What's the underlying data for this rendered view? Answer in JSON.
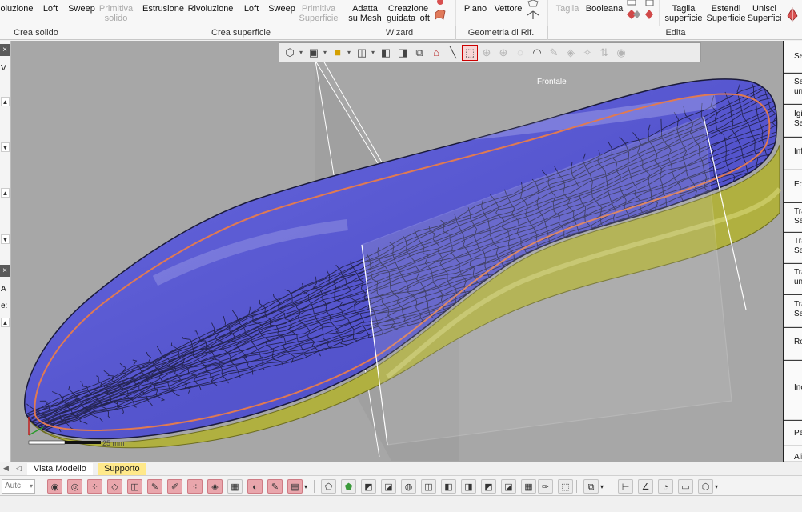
{
  "ribbon": {
    "crea_solido": {
      "group_label": "Crea solido",
      "buttons": [
        {
          "line1": "oluzione",
          "line2": "",
          "dim": false
        },
        {
          "line1": "Loft",
          "line2": "",
          "dim": false
        },
        {
          "line1": "Sweep",
          "line2": "",
          "dim": false
        },
        {
          "line1": "Primitiva",
          "line2": "solido",
          "dim": true
        }
      ]
    },
    "crea_superficie": {
      "group_label": "Crea superficie",
      "buttons": [
        {
          "line1": "Estrusione",
          "line2": "",
          "dim": false
        },
        {
          "line1": "Rivoluzione",
          "line2": "",
          "dim": false
        },
        {
          "line1": "Loft",
          "line2": "",
          "dim": false
        },
        {
          "line1": "Sweep",
          "line2": "",
          "dim": false
        },
        {
          "line1": "Primitiva",
          "line2": "Superficie",
          "dim": true
        }
      ]
    },
    "wizard": {
      "group_label": "Wizard",
      "buttons": [
        {
          "line1": "Adatta",
          "line2": "su Mesh",
          "dim": false
        },
        {
          "line1": "Creazione",
          "line2": "guidata loft",
          "dim": false
        }
      ]
    },
    "geometria": {
      "group_label": "Geometria di Rif.",
      "buttons": [
        {
          "line1": "Piano",
          "line2": "",
          "dim": false
        },
        {
          "line1": "Vettore",
          "line2": "",
          "dim": false
        }
      ]
    },
    "edita": {
      "group_label": "Edita",
      "buttons": [
        {
          "line1": "Taglia",
          "line2": "",
          "dim": true
        },
        {
          "line1": "Booleana",
          "line2": "",
          "dim": false
        },
        {
          "line1": "Taglia",
          "line2": "superficie",
          "dim": false
        },
        {
          "line1": "Estendi",
          "line2": "Superficie",
          "dim": false
        },
        {
          "line1": "Unisci",
          "line2": "Superfici",
          "dim": false
        }
      ]
    }
  },
  "left_panel": {
    "close_glyph": "×",
    "letters": [
      "V",
      "A",
      "e:"
    ]
  },
  "viewport": {
    "view_label": "Frontale",
    "scale_label": "25 mm",
    "colors": {
      "background": "#a7a7a7",
      "mesh_fill": "#5b5bd6",
      "mesh_lines": "#1c1c3a",
      "rim": "#b5b53a",
      "boundary_curve": "#e07a52",
      "plane_outline": "#ffffff"
    }
  },
  "view_toolbar": {
    "icons": [
      "view-cube-icon",
      "box-icon",
      "shading-icon",
      "box-outline-icon",
      "section-icon",
      "clip-icon",
      "mirror-icon",
      "floor-icon",
      "line-icon",
      "select-rect-icon",
      "snap-icon",
      "snap2-icon",
      "lasso-icon",
      "freeform-icon",
      "brush-icon",
      "paint-icon",
      "magic-icon",
      "transform-icon",
      "eye-icon"
    ]
  },
  "right_panel": {
    "items": [
      {
        "label": "Se",
        "label2": ""
      },
      {
        "label": "Se",
        "label2": "un"
      },
      {
        "label": "Igi",
        "label2": "Se"
      },
      {
        "label": "Inf",
        "label2": ""
      },
      {
        "label": "Ed",
        "label2": ""
      },
      {
        "label": "Tra",
        "label2": "Se"
      },
      {
        "label": "Tra",
        "label2": "Se"
      },
      {
        "label": "Tra",
        "label2": "un"
      },
      {
        "label": "Tra",
        "label2": "Se"
      },
      {
        "label": "Ro",
        "label2": ""
      },
      {
        "label": "Inc",
        "label2": ""
      },
      {
        "label": "Pa",
        "label2": ""
      },
      {
        "label": "Ali",
        "label2": ""
      }
    ]
  },
  "tabs": {
    "model_view": "Vista Modello",
    "support": "Supporto"
  },
  "bottom_toolbar": {
    "auto_select": "Autc",
    "dropdown_glyph": "▾"
  }
}
